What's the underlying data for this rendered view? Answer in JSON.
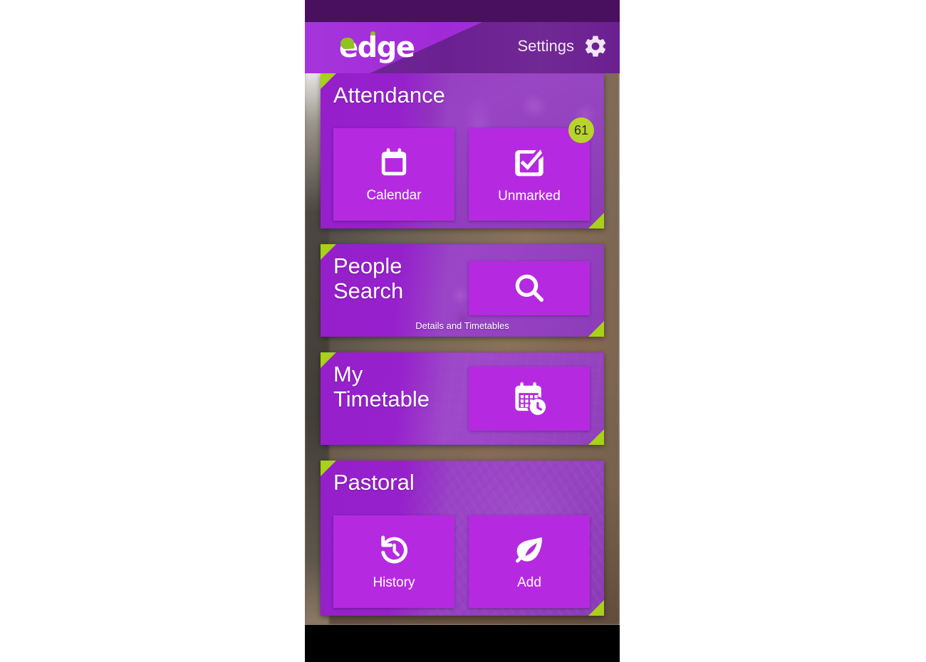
{
  "app": {
    "name": "edge",
    "logo_accent_color": "#8fc320",
    "header_bg": "#6b2091",
    "header_accent_bg": "#a12ad8",
    "status_bar_color": "#4a1060",
    "bottom_bar_color": "#000000"
  },
  "header": {
    "logo_text": "edge",
    "settings_label": "Settings",
    "settings_icon": "gear-icon"
  },
  "theme": {
    "card_tint": "#961ccd",
    "tile_color": "#b52ae0",
    "corner_accent": "#a8d117",
    "badge_color": "#b8d42a",
    "badge_text_color": "#2b2b2b",
    "text_color": "#ffffff"
  },
  "cards": [
    {
      "id": "attendance",
      "title": "Attendance",
      "subtitle": "",
      "tiles": [
        {
          "label": "Calendar",
          "icon": "calendar-icon",
          "badge": ""
        },
        {
          "label": "Unmarked",
          "icon": "check-square-icon",
          "badge": "61"
        }
      ]
    },
    {
      "id": "people-search",
      "title": "People\nSearch",
      "title_line1": "People",
      "title_line2": "Search",
      "subtitle": "Details and Timetables",
      "tiles": [
        {
          "label": "",
          "icon": "search-icon",
          "badge": ""
        }
      ]
    },
    {
      "id": "my-timetable",
      "title_line1": "My",
      "title_line2": "Timetable",
      "subtitle": "",
      "tiles": [
        {
          "label": "",
          "icon": "calendar-clock-icon",
          "badge": ""
        }
      ]
    },
    {
      "id": "pastoral",
      "title": "Pastoral",
      "subtitle": "",
      "tiles": [
        {
          "label": "History",
          "icon": "history-restore-icon",
          "badge": ""
        },
        {
          "label": "Add",
          "icon": "leaf-icon",
          "badge": ""
        }
      ]
    }
  ]
}
